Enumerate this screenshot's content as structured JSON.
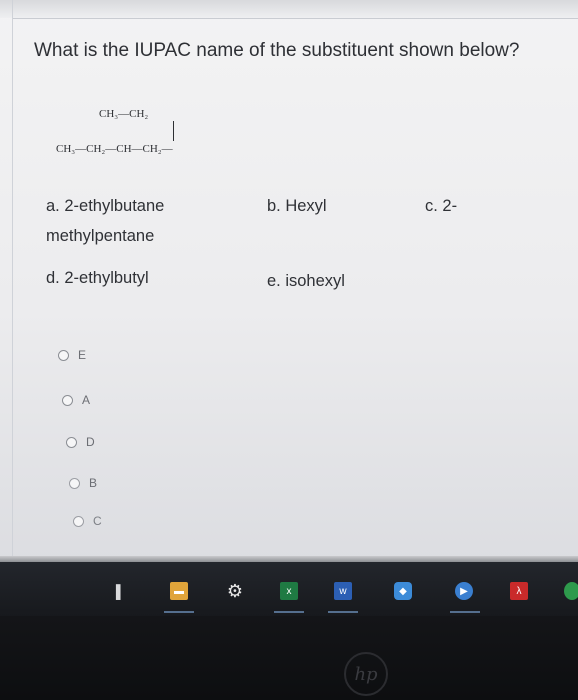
{
  "question": {
    "text": "What is the IUPAC name of the substituent shown below?"
  },
  "formula": {
    "top_row": "CH₃—CH₂",
    "bottom_row": "CH₃—CH₂—CH—CH₂—"
  },
  "choices": {
    "a_line1": "a. 2-ethylbutane",
    "a_line2": "methylpentane",
    "b": "b. Hexyl",
    "c": "c. 2-",
    "d": "d. 2-ethylbutyl",
    "e": "e. isohexyl"
  },
  "answer_options": [
    {
      "label": "E"
    },
    {
      "label": "A"
    },
    {
      "label": "D"
    },
    {
      "label": "B"
    },
    {
      "label": "C"
    }
  ],
  "taskbar": {
    "icons": [
      {
        "name": "task-view-icon",
        "glyph": "▐"
      },
      {
        "name": "file-explorer-icon",
        "glyph": "▬"
      },
      {
        "name": "settings-gear-icon",
        "glyph": "⚙"
      },
      {
        "name": "excel-icon",
        "glyph": "x"
      },
      {
        "name": "word-icon",
        "glyph": "w"
      },
      {
        "name": "app-icon",
        "glyph": "◆"
      },
      {
        "name": "camera-app-icon",
        "glyph": "▶"
      },
      {
        "name": "pdf-reader-icon",
        "glyph": "λ"
      },
      {
        "name": "chrome-icon",
        "glyph": ""
      }
    ]
  },
  "bezel": {
    "logo": "hp"
  }
}
